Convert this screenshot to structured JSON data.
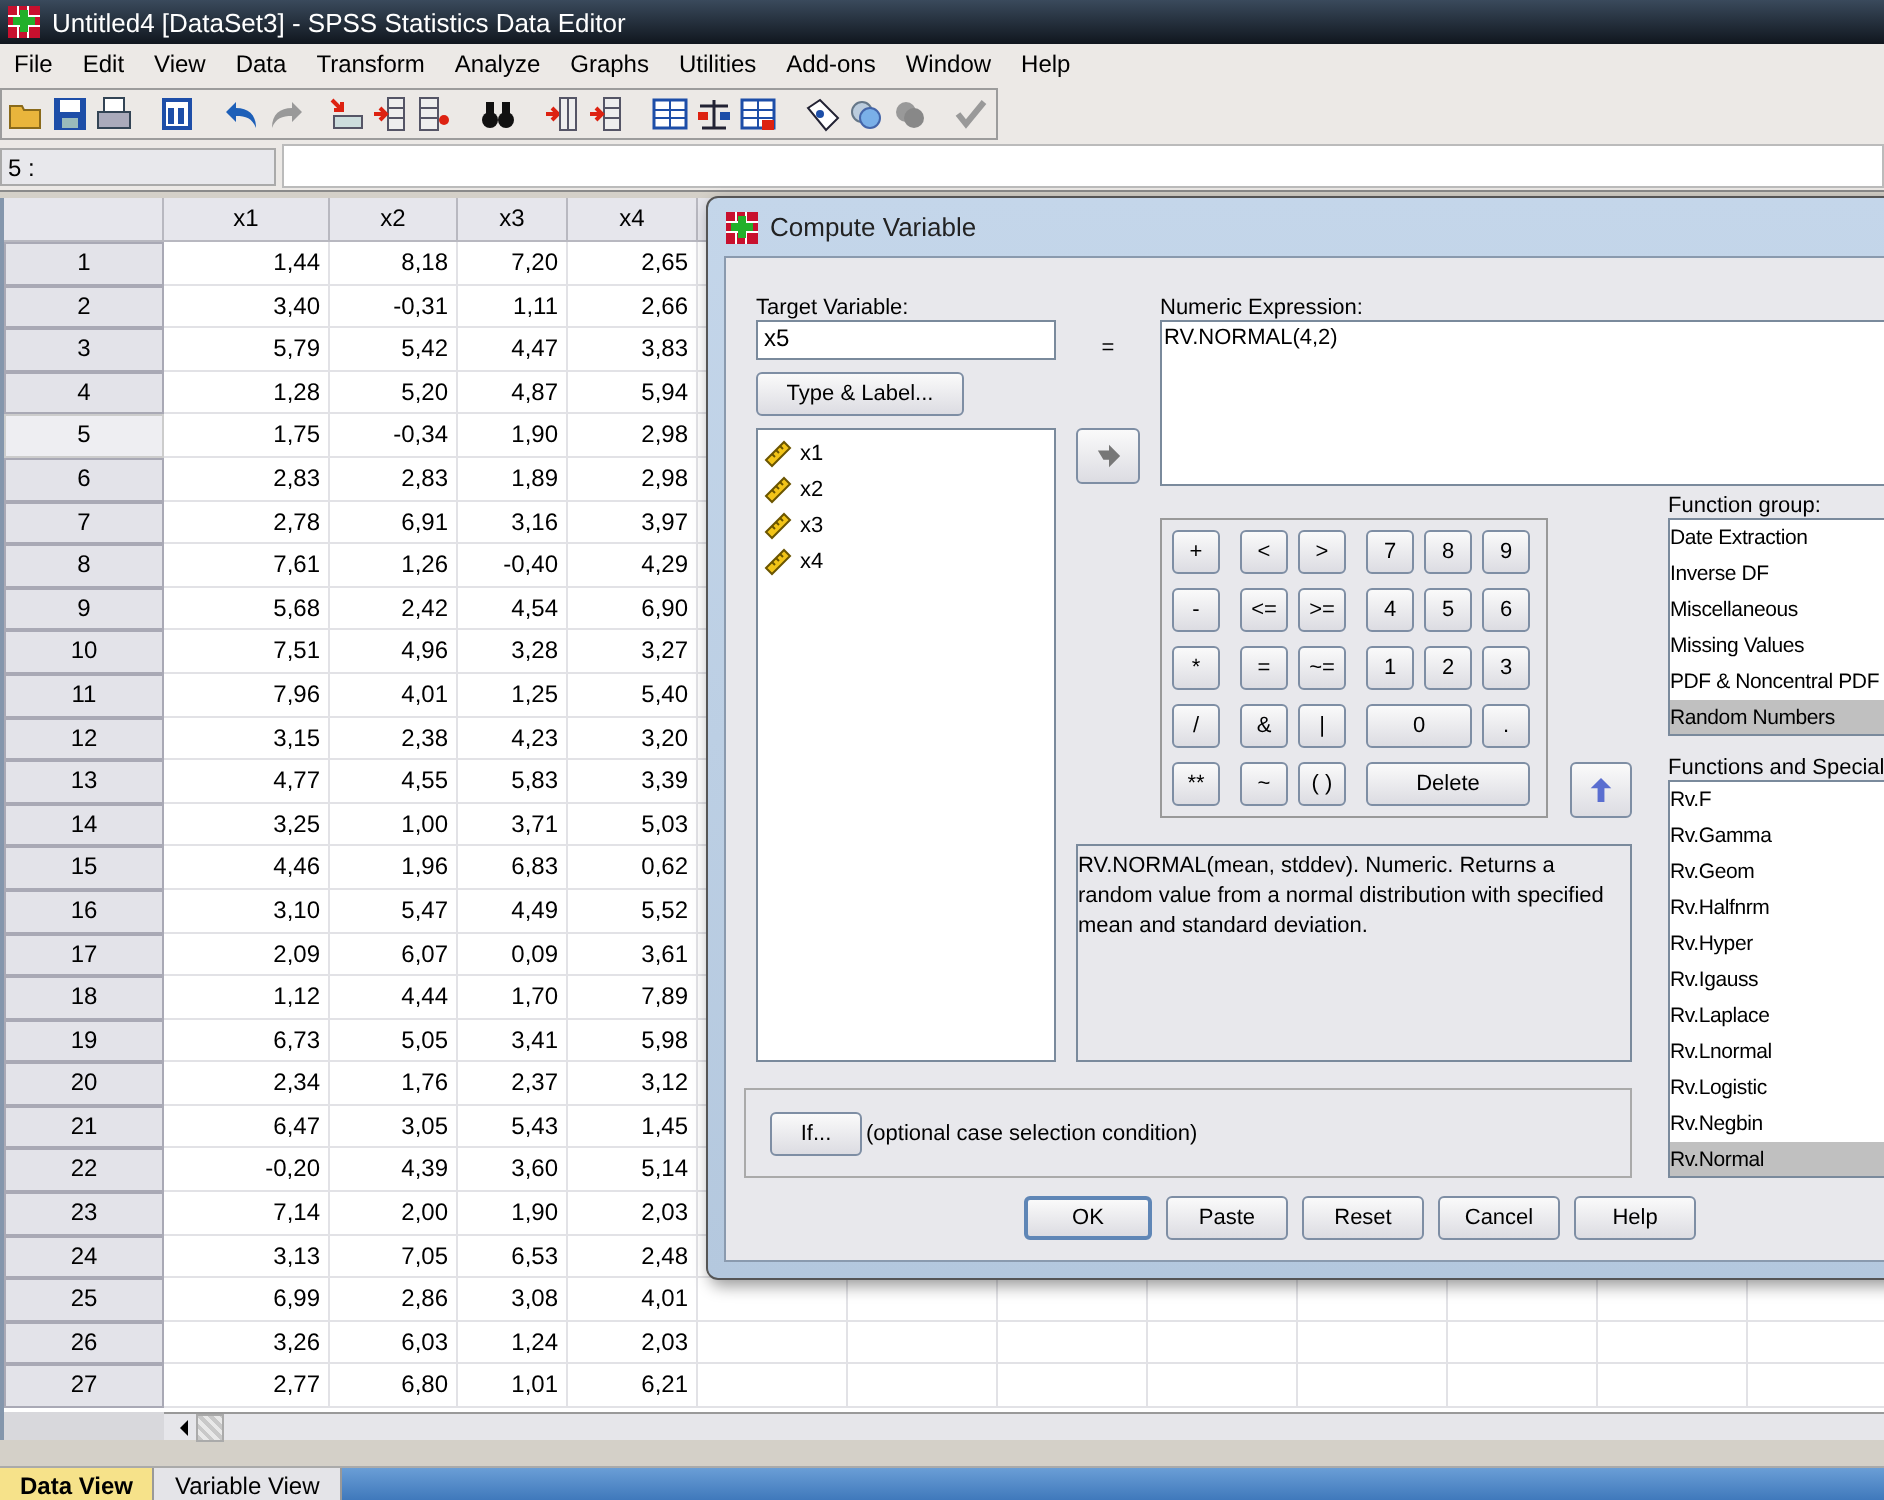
{
  "window": {
    "title": "Untitled4 [DataSet3] - SPSS Statistics Data Editor"
  },
  "menu": [
    "File",
    "Edit",
    "View",
    "Data",
    "Transform",
    "Analyze",
    "Graphs",
    "Utilities",
    "Add-ons",
    "Window",
    "Help"
  ],
  "cell_ref": {
    "label": "5 :"
  },
  "grid": {
    "columns": [
      "x1",
      "x2",
      "x3",
      "x4"
    ],
    "rows": [
      {
        "case": "1",
        "values": [
          "1,44",
          "8,18",
          "7,20",
          "2,65"
        ],
        "selected": false
      },
      {
        "case": "2",
        "values": [
          "3,40",
          "-0,31",
          "1,11",
          "2,66"
        ],
        "selected": false
      },
      {
        "case": "3",
        "values": [
          "5,79",
          "5,42",
          "4,47",
          "3,83"
        ],
        "selected": false
      },
      {
        "case": "4",
        "values": [
          "1,28",
          "5,20",
          "4,87",
          "5,94"
        ],
        "selected": false
      },
      {
        "case": "5",
        "values": [
          "1,75",
          "-0,34",
          "1,90",
          "2,98"
        ],
        "selected": true
      },
      {
        "case": "6",
        "values": [
          "2,83",
          "2,83",
          "1,89",
          "2,98"
        ],
        "selected": false
      },
      {
        "case": "7",
        "values": [
          "2,78",
          "6,91",
          "3,16",
          "3,97"
        ],
        "selected": false
      },
      {
        "case": "8",
        "values": [
          "7,61",
          "1,26",
          "-0,40",
          "4,29"
        ],
        "selected": false
      },
      {
        "case": "9",
        "values": [
          "5,68",
          "2,42",
          "4,54",
          "6,90"
        ],
        "selected": false
      },
      {
        "case": "10",
        "values": [
          "7,51",
          "4,96",
          "3,28",
          "3,27"
        ],
        "selected": false
      },
      {
        "case": "11",
        "values": [
          "7,96",
          "4,01",
          "1,25",
          "5,40"
        ],
        "selected": false
      },
      {
        "case": "12",
        "values": [
          "3,15",
          "2,38",
          "4,23",
          "3,20"
        ],
        "selected": false
      },
      {
        "case": "13",
        "values": [
          "4,77",
          "4,55",
          "5,83",
          "3,39"
        ],
        "selected": false
      },
      {
        "case": "14",
        "values": [
          "3,25",
          "1,00",
          "3,71",
          "5,03"
        ],
        "selected": false
      },
      {
        "case": "15",
        "values": [
          "4,46",
          "1,96",
          "6,83",
          "0,62"
        ],
        "selected": false
      },
      {
        "case": "16",
        "values": [
          "3,10",
          "5,47",
          "4,49",
          "5,52"
        ],
        "selected": false
      },
      {
        "case": "17",
        "values": [
          "2,09",
          "6,07",
          "0,09",
          "3,61"
        ],
        "selected": false
      },
      {
        "case": "18",
        "values": [
          "1,12",
          "4,44",
          "1,70",
          "7,89"
        ],
        "selected": false
      },
      {
        "case": "19",
        "values": [
          "6,73",
          "5,05",
          "3,41",
          "5,98"
        ],
        "selected": false
      },
      {
        "case": "20",
        "values": [
          "2,34",
          "1,76",
          "2,37",
          "3,12"
        ],
        "selected": false
      },
      {
        "case": "21",
        "values": [
          "6,47",
          "3,05",
          "5,43",
          "1,45"
        ],
        "selected": false
      },
      {
        "case": "22",
        "values": [
          "-0,20",
          "4,39",
          "3,60",
          "5,14"
        ],
        "selected": false
      },
      {
        "case": "23",
        "values": [
          "7,14",
          "2,00",
          "1,90",
          "2,03"
        ],
        "selected": false
      },
      {
        "case": "24",
        "values": [
          "3,13",
          "7,05",
          "6,53",
          "2,48"
        ],
        "selected": false
      },
      {
        "case": "25",
        "values": [
          "6,99",
          "2,86",
          "3,08",
          "4,01"
        ],
        "selected": false
      },
      {
        "case": "26",
        "values": [
          "3,26",
          "6,03",
          "1,24",
          "2,03"
        ],
        "selected": false
      },
      {
        "case": "27",
        "values": [
          "2,77",
          "6,80",
          "1,01",
          "6,21"
        ],
        "selected": false
      }
    ]
  },
  "tabs": [
    {
      "label": "Data View",
      "selected": true
    },
    {
      "label": "Variable View",
      "selected": false
    }
  ],
  "dialog": {
    "title": "Compute Variable",
    "target_label": "Target Variable:",
    "target_value": "x5",
    "type_label_button": "Type & Label...",
    "equals": "=",
    "expression_label": "Numeric Expression:",
    "expression": "RV.NORMAL(4,2)",
    "variables": [
      "x1",
      "x2",
      "x3",
      "x4"
    ],
    "keypad": [
      [
        "+",
        "<",
        ">",
        "7",
        "8",
        "9"
      ],
      [
        "-",
        "<=",
        ">=",
        "4",
        "5",
        "6"
      ],
      [
        "*",
        "=",
        "~=",
        "1",
        "2",
        "3"
      ],
      [
        "/",
        "&",
        "|",
        "0",
        "."
      ],
      [
        "**",
        "~",
        "( )",
        "Delete"
      ]
    ],
    "description": "RV.NORMAL(mean, stddev). Numeric. Returns a random value from a normal distribution with specified mean and standard deviation.",
    "function_group_label": "Function group:",
    "function_groups": [
      {
        "label": "Date Extraction",
        "selected": false
      },
      {
        "label": "Inverse DF",
        "selected": false
      },
      {
        "label": "Miscellaneous",
        "selected": false
      },
      {
        "label": "Missing Values",
        "selected": false
      },
      {
        "label": "PDF & Noncentral PDF",
        "selected": false
      },
      {
        "label": "Random Numbers",
        "selected": true
      }
    ],
    "functions_label": "Functions and Special",
    "functions": [
      {
        "label": "Rv.F",
        "selected": false
      },
      {
        "label": "Rv.Gamma",
        "selected": false
      },
      {
        "label": "Rv.Geom",
        "selected": false
      },
      {
        "label": "Rv.Halfnrm",
        "selected": false
      },
      {
        "label": "Rv.Hyper",
        "selected": false
      },
      {
        "label": "Rv.Igauss",
        "selected": false
      },
      {
        "label": "Rv.Laplace",
        "selected": false
      },
      {
        "label": "Rv.Lnormal",
        "selected": false
      },
      {
        "label": "Rv.Logistic",
        "selected": false
      },
      {
        "label": "Rv.Negbin",
        "selected": false
      },
      {
        "label": "Rv.Normal",
        "selected": true
      }
    ],
    "if_button": "If...",
    "if_note": "(optional case selection condition)",
    "buttons": [
      {
        "label": "OK",
        "default": true
      },
      {
        "label": "Paste",
        "default": false
      },
      {
        "label": "Reset",
        "default": false
      },
      {
        "label": "Cancel",
        "default": false
      },
      {
        "label": "Help",
        "default": false
      }
    ]
  }
}
